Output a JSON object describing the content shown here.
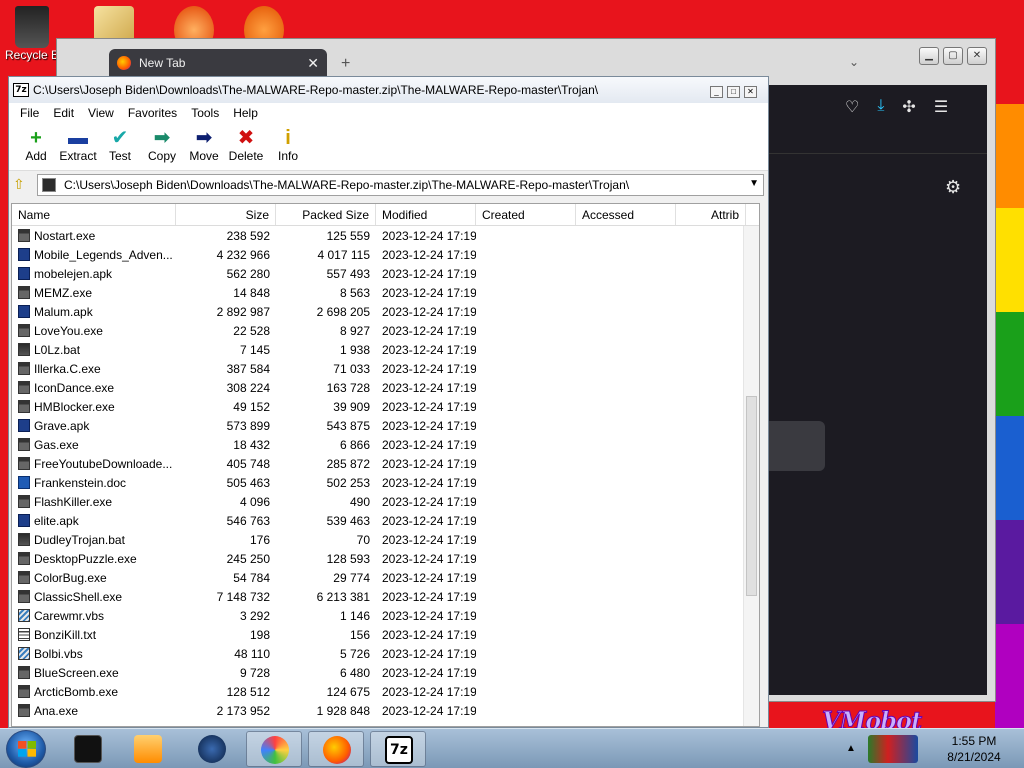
{
  "desktop": {
    "recycle_bin_label": "Recycle B",
    "watermark": "VMobot"
  },
  "browser": {
    "tab_title": "New Tab",
    "tab_close": "✕",
    "new_tab": "+",
    "tab_list": "⌄",
    "toolbar_icons": [
      "pocket-icon",
      "download-icon",
      "extensions-icon",
      "menu-icon"
    ]
  },
  "sevenzip": {
    "app_icon": "7z",
    "title": "C:\\Users\\Joseph Biden\\Downloads\\The-MALWARE-Repo-master.zip\\The-MALWARE-Repo-master\\Trojan\\",
    "menu": [
      "File",
      "Edit",
      "View",
      "Favorites",
      "Tools",
      "Help"
    ],
    "toolbar": [
      {
        "label": "Add",
        "icon": "+",
        "color": "#1aa01a"
      },
      {
        "label": "Extract",
        "icon": "▬",
        "color": "#1a3fa0"
      },
      {
        "label": "Test",
        "icon": "✔",
        "color": "#18a8a8"
      },
      {
        "label": "Copy",
        "icon": "➡",
        "color": "#1a8a6a"
      },
      {
        "label": "Move",
        "icon": "➡",
        "color": "#0d1f70"
      },
      {
        "label": "Delete",
        "icon": "✖",
        "color": "#d01010"
      },
      {
        "label": "Info",
        "icon": "i",
        "color": "#d0a000"
      }
    ],
    "address": "C:\\Users\\Joseph Biden\\Downloads\\The-MALWARE-Repo-master.zip\\The-MALWARE-Repo-master\\Trojan\\",
    "columns": [
      "Name",
      "Size",
      "Packed Size",
      "Modified",
      "Created",
      "Accessed",
      "Attrib"
    ],
    "files": [
      {
        "name": "Nostart.exe",
        "type": "exe",
        "size": "238 592",
        "packed": "125 559",
        "modified": "2023-12-24 17:19"
      },
      {
        "name": "Mobile_Legends_Adven...",
        "type": "apk",
        "size": "4 232 966",
        "packed": "4 017 115",
        "modified": "2023-12-24 17:19"
      },
      {
        "name": "mobelejen.apk",
        "type": "apk",
        "size": "562 280",
        "packed": "557 493",
        "modified": "2023-12-24 17:19"
      },
      {
        "name": "MEMZ.exe",
        "type": "exe",
        "size": "14 848",
        "packed": "8 563",
        "modified": "2023-12-24 17:19"
      },
      {
        "name": "Malum.apk",
        "type": "apk",
        "size": "2 892 987",
        "packed": "2 698 205",
        "modified": "2023-12-24 17:19"
      },
      {
        "name": "LoveYou.exe",
        "type": "exe",
        "size": "22 528",
        "packed": "8 927",
        "modified": "2023-12-24 17:19"
      },
      {
        "name": "L0Lz.bat",
        "type": "bat",
        "size": "7 145",
        "packed": "1 938",
        "modified": "2023-12-24 17:19"
      },
      {
        "name": "Illerka.C.exe",
        "type": "exe",
        "size": "387 584",
        "packed": "71 033",
        "modified": "2023-12-24 17:19"
      },
      {
        "name": "IconDance.exe",
        "type": "exe",
        "size": "308 224",
        "packed": "163 728",
        "modified": "2023-12-24 17:19"
      },
      {
        "name": "HMBlocker.exe",
        "type": "exe",
        "size": "49 152",
        "packed": "39 909",
        "modified": "2023-12-24 17:19"
      },
      {
        "name": "Grave.apk",
        "type": "apk",
        "size": "573 899",
        "packed": "543 875",
        "modified": "2023-12-24 17:19"
      },
      {
        "name": "Gas.exe",
        "type": "exe",
        "size": "18 432",
        "packed": "6 866",
        "modified": "2023-12-24 17:19"
      },
      {
        "name": "FreeYoutubeDownloade...",
        "type": "exe",
        "size": "405 748",
        "packed": "285 872",
        "modified": "2023-12-24 17:19"
      },
      {
        "name": "Frankenstein.doc",
        "type": "doc",
        "size": "505 463",
        "packed": "502 253",
        "modified": "2023-12-24 17:19"
      },
      {
        "name": "FlashKiller.exe",
        "type": "exe",
        "size": "4 096",
        "packed": "490",
        "modified": "2023-12-24 17:19"
      },
      {
        "name": "elite.apk",
        "type": "apk",
        "size": "546 763",
        "packed": "539 463",
        "modified": "2023-12-24 17:19"
      },
      {
        "name": "DudleyTrojan.bat",
        "type": "bat",
        "size": "176",
        "packed": "70",
        "modified": "2023-12-24 17:19"
      },
      {
        "name": "DesktopPuzzle.exe",
        "type": "exe",
        "size": "245 250",
        "packed": "128 593",
        "modified": "2023-12-24 17:19"
      },
      {
        "name": "ColorBug.exe",
        "type": "exe",
        "size": "54 784",
        "packed": "29 774",
        "modified": "2023-12-24 17:19"
      },
      {
        "name": "ClassicShell.exe",
        "type": "exe",
        "size": "7 148 732",
        "packed": "6 213 381",
        "modified": "2023-12-24 17:19"
      },
      {
        "name": "Carewmr.vbs",
        "type": "vbs",
        "size": "3 292",
        "packed": "1 146",
        "modified": "2023-12-24 17:19"
      },
      {
        "name": "BonziKill.txt",
        "type": "txt",
        "size": "198",
        "packed": "156",
        "modified": "2023-12-24 17:19"
      },
      {
        "name": "Bolbi.vbs",
        "type": "vbs",
        "size": "48 110",
        "packed": "5 726",
        "modified": "2023-12-24 17:19"
      },
      {
        "name": "BlueScreen.exe",
        "type": "exe",
        "size": "9 728",
        "packed": "6 480",
        "modified": "2023-12-24 17:19"
      },
      {
        "name": "ArcticBomb.exe",
        "type": "exe",
        "size": "128 512",
        "packed": "124 675",
        "modified": "2023-12-24 17:19"
      },
      {
        "name": "Ana.exe",
        "type": "exe",
        "size": "2 173 952",
        "packed": "1 928 848",
        "modified": "2023-12-24 17:19"
      }
    ]
  },
  "taskbar": {
    "apps": [
      "cmd-icon",
      "media-player-icon",
      "globe-icon",
      "paint-icon",
      "firefox-icon",
      "7zip-icon"
    ],
    "clock_time": "1:55 PM",
    "clock_date": "8/21/2024"
  },
  "colors": {
    "rainbow": [
      "#e8141c",
      "#ff8c00",
      "#ffe000",
      "#1aa01a",
      "#1a5fd0",
      "#5a1aa0",
      "#b000c0"
    ]
  }
}
